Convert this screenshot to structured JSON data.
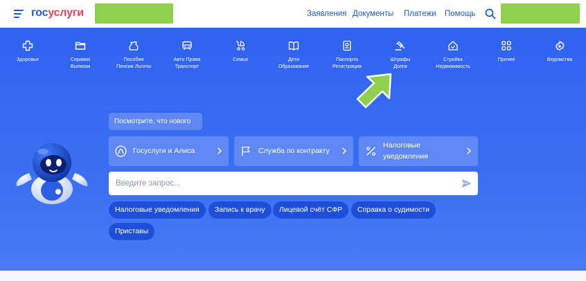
{
  "header": {
    "logo_part1": "гос",
    "logo_part2": "услуги",
    "nav": [
      "Заявления",
      "Документы",
      "Платежи",
      "Помощь"
    ]
  },
  "categories": [
    {
      "icon": "plus-cross-icon",
      "label": "Здоровье"
    },
    {
      "icon": "folder-icon",
      "label": "Справки\nВыписки"
    },
    {
      "icon": "wallet-bag-icon",
      "label": "Пособия\nПенсия Льготы"
    },
    {
      "icon": "car-icon",
      "label": "Авто Права\nТранспорт"
    },
    {
      "icon": "stroller-icon",
      "label": "Семья"
    },
    {
      "icon": "book-icon",
      "label": "Дети\nОбразование"
    },
    {
      "icon": "passport-icon",
      "label": "Паспорта\nРегистрация"
    },
    {
      "icon": "gavel-icon",
      "label": "Штрафы\nДолги"
    },
    {
      "icon": "house-icon",
      "label": "Стройка\nНедвижимость"
    },
    {
      "icon": "grid-icon",
      "label": "Прочее"
    },
    {
      "icon": "emblem-icon",
      "label": "Ведомства"
    }
  ],
  "hero": {
    "whats_new": "Посмотрите, что нового",
    "cards": [
      {
        "icon": "alice-icon",
        "label": "Госуслуги и Алиса"
      },
      {
        "icon": "flag-icon",
        "label": "Служба по контракту"
      },
      {
        "icon": "percent-icon",
        "label_line1": "Налоговые",
        "label_line2": "уведомления"
      }
    ],
    "search_placeholder": "Введите запрос...",
    "quick_links": [
      "Налоговые уведомления",
      "Запись к врачу",
      "Лицевой счёт СФР",
      "Справка о судимости",
      "Приставы"
    ]
  },
  "colors": {
    "brand_blue": "#1d5ad9",
    "brand_red": "#ee3f58",
    "hero_bg": "#3b6ff2",
    "card_bg": "#5f88f5",
    "pill_bg": "#1f4fd8",
    "highlight_green": "#8fd14f"
  }
}
